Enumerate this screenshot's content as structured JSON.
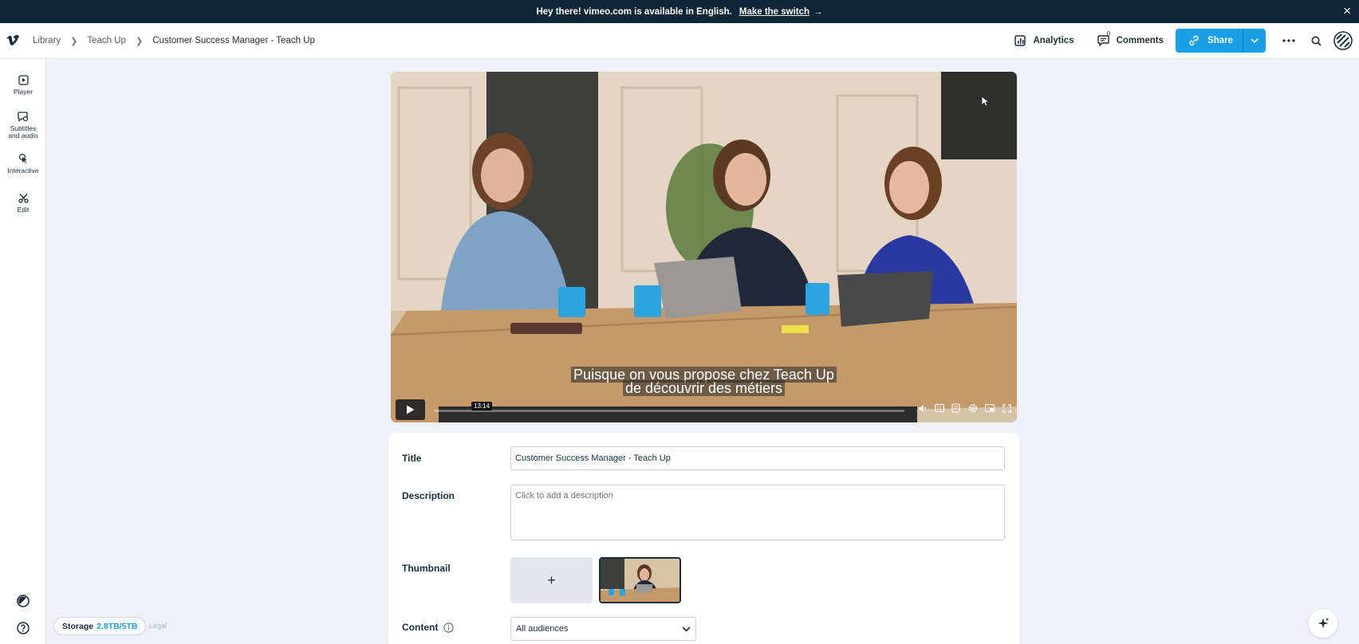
{
  "banner": {
    "message": "Hey there! vimeo.com is available in English.",
    "link": "Make the switch",
    "arrow": "→",
    "close": "×"
  },
  "breadcrumb": {
    "items": [
      "Library",
      "Teach Up",
      "Customer Success Manager - Teach Up"
    ]
  },
  "header": {
    "analytics_label": "Analytics",
    "comments_label": "Comments",
    "comments_count": "0",
    "share_label": "Share"
  },
  "sidebar": {
    "items": [
      {
        "label": "Player",
        "icon": "play-square-icon"
      },
      {
        "label": "Subtitles and audio",
        "icon": "subtitles-icon"
      },
      {
        "label": "Interactive",
        "icon": "tap-icon"
      },
      {
        "label": "Edit",
        "icon": "scissors-icon"
      }
    ]
  },
  "video": {
    "subtitle_line1": "Puisque on vous propose chez Teach Up",
    "subtitle_line2": "de découvrir des métiers",
    "timecode": "13:14",
    "progress": 0
  },
  "form": {
    "title_label": "Title",
    "title_value": "Customer Success Manager - Teach Up",
    "description_label": "Description",
    "description_placeholder": "Click to add a description",
    "thumbnail_label": "Thumbnail",
    "thumbnail_add": "+",
    "content_label": "Content",
    "content_value": "All audiences"
  },
  "storage": {
    "label": "Storage",
    "value": "2.8TB/5TB"
  },
  "legal": "Legal",
  "colors": {
    "accent": "#17a0e6",
    "banner_bg": "#0d2638",
    "page_bg": "#eef1f6"
  }
}
